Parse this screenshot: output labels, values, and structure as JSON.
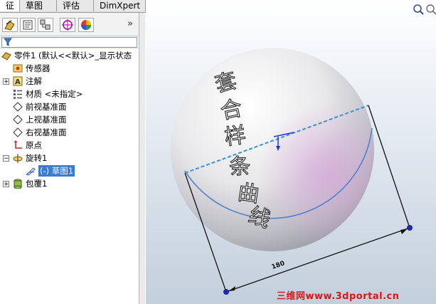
{
  "tabs": [
    {
      "label": "征",
      "active": true
    },
    {
      "label": "草图",
      "active": false
    },
    {
      "label": "评估",
      "active": false
    },
    {
      "label": "DimXpert",
      "active": false
    }
  ],
  "panel": {
    "icons": [
      "feature-manager-icon",
      "property-manager-icon",
      "configuration-manager-icon",
      "dimxpert-manager-icon",
      "display-manager-icon"
    ],
    "expand_glyph": "»"
  },
  "tree": {
    "root_label": "零件1   (默认<<默认>_显示状态",
    "items": [
      {
        "label": "传感器",
        "icon": "sensor-icon",
        "expand": ""
      },
      {
        "label": "注解",
        "icon": "annotation-icon",
        "expand": "+"
      },
      {
        "label": "材质 <未指定>",
        "icon": "material-icon",
        "expand": ""
      },
      {
        "label": "前视基准面",
        "icon": "plane-icon",
        "expand": ""
      },
      {
        "label": "上视基准面",
        "icon": "plane-icon",
        "expand": ""
      },
      {
        "label": "右视基准面",
        "icon": "plane-icon",
        "expand": ""
      },
      {
        "label": "原点",
        "icon": "origin-icon",
        "expand": ""
      },
      {
        "label": "旋转1",
        "icon": "revolve-icon",
        "expand": "−"
      },
      {
        "label": "(-) 草图1",
        "icon": "sketch-icon",
        "expand": "",
        "selected": true
      },
      {
        "label": "包覆1",
        "icon": "wrap-icon",
        "expand": "+"
      }
    ]
  },
  "viewport": {
    "engraved_text": [
      "套",
      "合",
      "样",
      "条",
      "曲",
      "线"
    ],
    "dimension_value": "180",
    "watermark": "三维网www.3dportal.cn",
    "colors": {
      "selection": "#3a7bd5",
      "dimension_line": "#111111",
      "sketch_line": "#3a8fd8",
      "watermark": "#d81818"
    }
  }
}
